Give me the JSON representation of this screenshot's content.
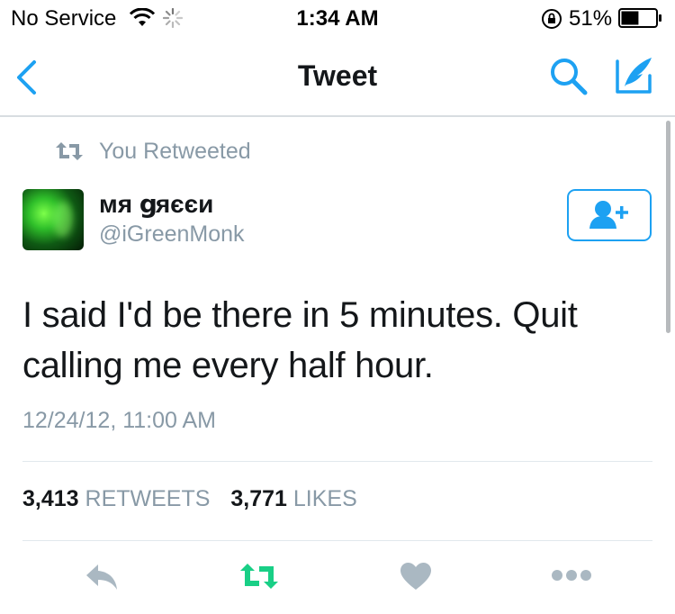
{
  "status_bar": {
    "carrier": "No Service",
    "time": "1:34 AM",
    "battery_percent": "51%",
    "battery_level": 0.51,
    "icons": [
      "wifi-icon",
      "activity-spinner-icon",
      "orientation-lock-icon",
      "battery-icon"
    ]
  },
  "nav": {
    "title": "Tweet",
    "icons": [
      "chevron-left-icon",
      "search-icon",
      "compose-icon"
    ]
  },
  "tweet": {
    "retweet_context": "You Retweeted",
    "author_name": "мя ցяєєи",
    "author_handle": "@iGreenMonk",
    "text": "I said I'd be there in 5 minutes. Quit calling me every half hour.",
    "timestamp": "12/24/12, 11:00 AM",
    "retweets_count": "3,413",
    "retweets_label": "RETWEETS",
    "likes_count": "3,771",
    "likes_label": "LIKES",
    "retweeted": true
  },
  "actions": [
    "reply-icon",
    "retweet-icon",
    "like-icon",
    "more-icon"
  ],
  "colors": {
    "accent": "#1da1f2",
    "retweet_active": "#19cf86",
    "muted": "#8899a6",
    "icon_gray": "#aab8c2",
    "text": "#14171a"
  }
}
